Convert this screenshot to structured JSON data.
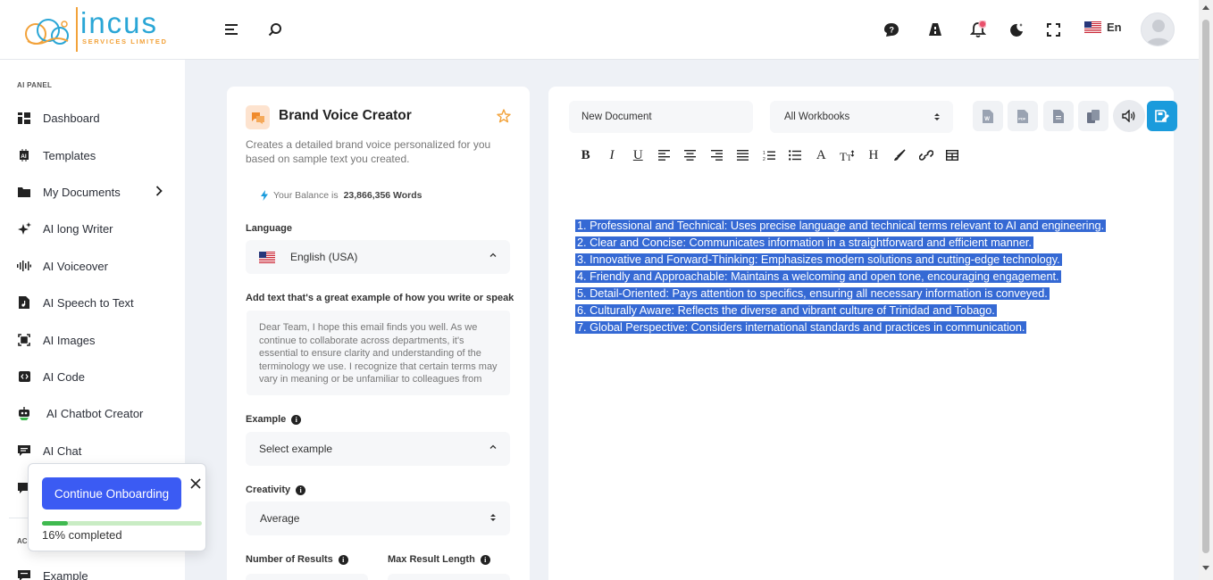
{
  "brand": {
    "name": "incus",
    "tagline": "SERVICES LIMITED"
  },
  "header": {
    "language": "En",
    "icons": [
      "menu-icon",
      "search-icon",
      "chat-icon",
      "dashboard-icon",
      "bell-icon",
      "dark-mode-icon",
      "fullscreen-icon"
    ]
  },
  "sidebar": {
    "panel_title": "AI PANEL",
    "items": [
      {
        "label": "Dashboard",
        "icon": "grid-icon"
      },
      {
        "label": "Templates",
        "icon": "ai-chip-icon"
      },
      {
        "label": "My Documents",
        "icon": "folder-icon"
      },
      {
        "label": "AI long Writer",
        "icon": "sparkle-icon"
      },
      {
        "label": "AI Voiceover",
        "icon": "waveform-icon"
      },
      {
        "label": "AI Speech to Text",
        "icon": "audio-file-icon"
      },
      {
        "label": "AI Images",
        "icon": "image-scan-icon"
      },
      {
        "label": "AI Code",
        "icon": "code-icon"
      },
      {
        "label": "AI Chatbot Creator",
        "icon": "bot-icon"
      },
      {
        "label": "AI Chat",
        "icon": "chat-bubble-icon"
      },
      {
        "label": "Example",
        "icon": "chat-bubble-icon"
      }
    ],
    "section_label": "AC"
  },
  "onboarding": {
    "button_label": "Continue Onboarding",
    "progress_text": "16% completed",
    "progress": 0.16
  },
  "tool": {
    "title": "Brand Voice Creator",
    "description": "Creates a detailed brand voice personalized for you based on sample text you created.",
    "balance_prefix": "Your Balance is",
    "balance_value": "23,866,356 Words",
    "language_label": "Language",
    "language_value": "English (USA)",
    "sample_label": "Add text that's a great example of how you write or speak",
    "sample_text": "Dear Team,  I hope this email finds you well. As we continue to collaborate across departments, it's essential to ensure clarity and understanding of the terminology we use. I recognize that certain terms may vary in meaning or be unfamiliar to colleagues from",
    "example_label": "Example",
    "example_value": "Select example",
    "creativity_label": "Creativity",
    "creativity_value": "Average",
    "num_results_label": "Number of Results",
    "max_length_label": "Max Result Length"
  },
  "document": {
    "name": "New Document",
    "workbook": "All Workbooks",
    "toolbar_buttons": [
      "word-export-icon",
      "pdf-export-icon",
      "text-export-icon",
      "copy-icon",
      "speaker-icon",
      "save-icon"
    ],
    "format_tools": [
      "bold",
      "italic",
      "underline",
      "align-left",
      "align-center",
      "align-right",
      "justify",
      "ordered-list",
      "bullet-list",
      "font",
      "text-size",
      "heading",
      "brush",
      "link",
      "table"
    ],
    "lines": [
      "1. Professional and Technical: Uses precise language and technical terms relevant to AI and engineering.",
      "2. Clear and Concise: Communicates information in a straightforward and efficient manner.",
      "3. Innovative and Forward-Thinking: Emphasizes modern solutions and cutting-edge technology.",
      "4. Friendly and Approachable: Maintains a welcoming and open tone, encouraging engagement.",
      "5. Detail-Oriented: Pays attention to specifics, ensuring all necessary information is conveyed.",
      "6. Culturally Aware: Reflects the diverse and vibrant culture of Trinidad and Tobago.",
      "7. Global Perspective: Considers international standards and practices in communication."
    ]
  },
  "colors": {
    "accent": "#3b5bf3",
    "brand_blue": "#2aa6d6",
    "brand_orange": "#f2a23a",
    "selection": "#3569d4",
    "save_button": "#1a9bdc"
  }
}
